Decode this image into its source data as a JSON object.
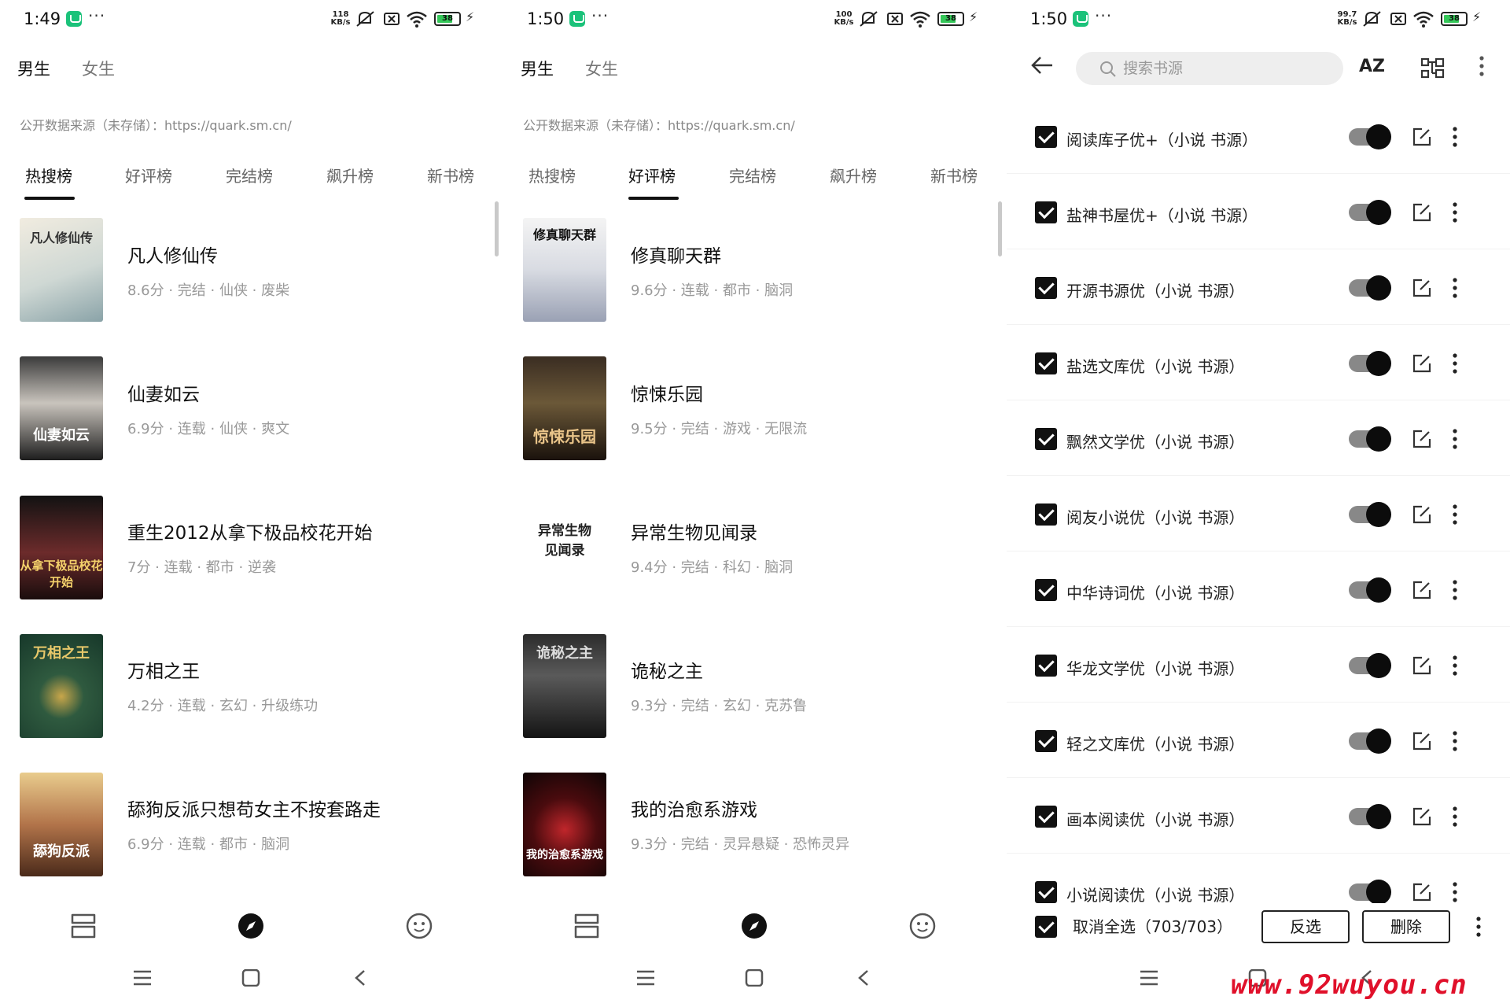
{
  "panel1": {
    "status": {
      "time": "1:49",
      "dots": "···",
      "speed": "118 KB/s",
      "battery": "38"
    },
    "gender_tabs": [
      "男生",
      "女生"
    ],
    "source_line": "公开数据来源（未存储）：https://quark.sm.cn/",
    "rank_tabs": [
      "热搜榜",
      "好评榜",
      "完结榜",
      "飙升榜",
      "新书榜"
    ],
    "active_rank": 0,
    "books": [
      {
        "title": "凡人修仙传",
        "meta": "8.6分 · 完结 · 仙侠 · 废柴",
        "cover_text": "凡人修仙传"
      },
      {
        "title": "仙妻如云",
        "meta": "6.9分 · 连载 · 仙侠 · 爽文",
        "cover_text": "仙妻如云"
      },
      {
        "title": "重生2012从拿下极品校花开始",
        "meta": "7分 · 连载 · 都市 · 逆袭",
        "cover_text": "从拿下极品校花开始"
      },
      {
        "title": "万相之王",
        "meta": "4.2分 · 连载 · 玄幻 · 升级练功",
        "cover_text": "万相之王"
      },
      {
        "title": "舔狗反派只想苟女主不按套路走",
        "meta": "6.9分 · 连载 · 都市 · 脑洞",
        "cover_text": "舔狗反派"
      }
    ]
  },
  "panel2": {
    "status": {
      "time": "1:50",
      "dots": "···",
      "speed": "100 KB/s",
      "battery": "38"
    },
    "gender_tabs": [
      "男生",
      "女生"
    ],
    "source_line": "公开数据来源（未存储）：https://quark.sm.cn/",
    "rank_tabs": [
      "热搜榜",
      "好评榜",
      "完结榜",
      "飙升榜",
      "新书榜"
    ],
    "active_rank": 1,
    "books": [
      {
        "title": "修真聊天群",
        "meta": "9.6分 · 连载 · 都市 · 脑洞",
        "cover_text": "修真聊天群"
      },
      {
        "title": "惊悚乐园",
        "meta": "9.5分 · 完结 · 游戏 · 无限流",
        "cover_text": "惊悚乐园"
      },
      {
        "title": "异常生物见闻录",
        "meta": "9.4分 · 完结 · 科幻 · 脑洞",
        "cover_text": "异常生物 见闻录"
      },
      {
        "title": "诡秘之主",
        "meta": "9.3分 · 完结 · 玄幻 · 克苏鲁",
        "cover_text": "诡秘之主"
      },
      {
        "title": "我的治愈系游戏",
        "meta": "9.3分 · 完结 · 灵异悬疑 · 恐怖灵异",
        "cover_text": "我的治愈系游戏"
      }
    ]
  },
  "panel3": {
    "status": {
      "time": "1:50",
      "dots": "···",
      "speed": "99.7 KB/s",
      "battery": "38"
    },
    "search_placeholder": "搜索书源",
    "az_label": "AZ",
    "sources": [
      "阅读库子优+（小说 书源）",
      "盐神书屋优+（小说 书源）",
      "开源书源优（小说 书源）",
      "盐选文库优（小说 书源）",
      "飘然文学优（小说 书源）",
      "阅友小说优（小说 书源）",
      "中华诗词优（小说 书源）",
      "华龙文学优（小说 书源）",
      "轻之文库优（小说 书源）",
      "画本阅读优（小说 书源）",
      "小说阅读优（小说 书源）"
    ],
    "select_all_label": "取消全选（703/703）",
    "invert_label": "反选",
    "delete_label": "删除"
  },
  "watermark": "www.92wuyou.cn",
  "colors": {
    "accent_green": "#1bc27a",
    "battery_green": "#35c759",
    "watermark_red": "#e0102a"
  }
}
